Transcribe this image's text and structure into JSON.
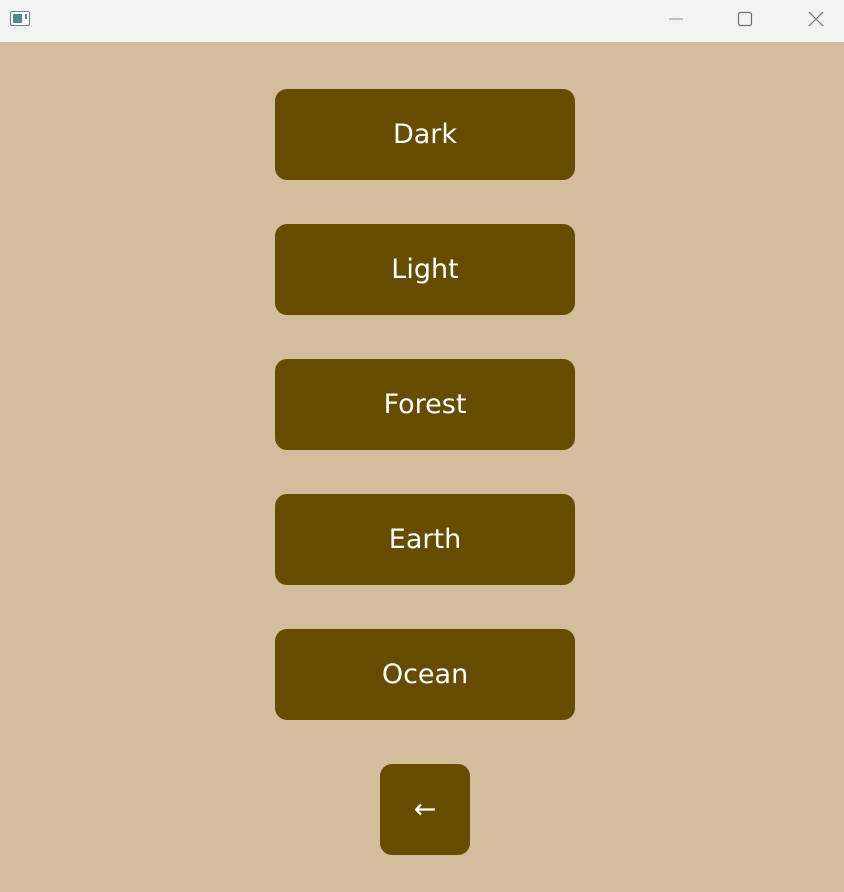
{
  "window": {
    "background_color": "#d4bd9c",
    "titlebar_color": "#f3f3f3",
    "controls": {
      "minimize_icon": "minimize-icon",
      "maximize_icon": "maximize-icon",
      "close_icon": "close-icon"
    }
  },
  "themes": {
    "button_color": "#654c00",
    "text_color": "#ffffff",
    "items": [
      {
        "label": "Dark"
      },
      {
        "label": "Light"
      },
      {
        "label": "Forest"
      },
      {
        "label": "Earth"
      },
      {
        "label": "Ocean"
      }
    ]
  },
  "navigation": {
    "back_label": "←"
  }
}
